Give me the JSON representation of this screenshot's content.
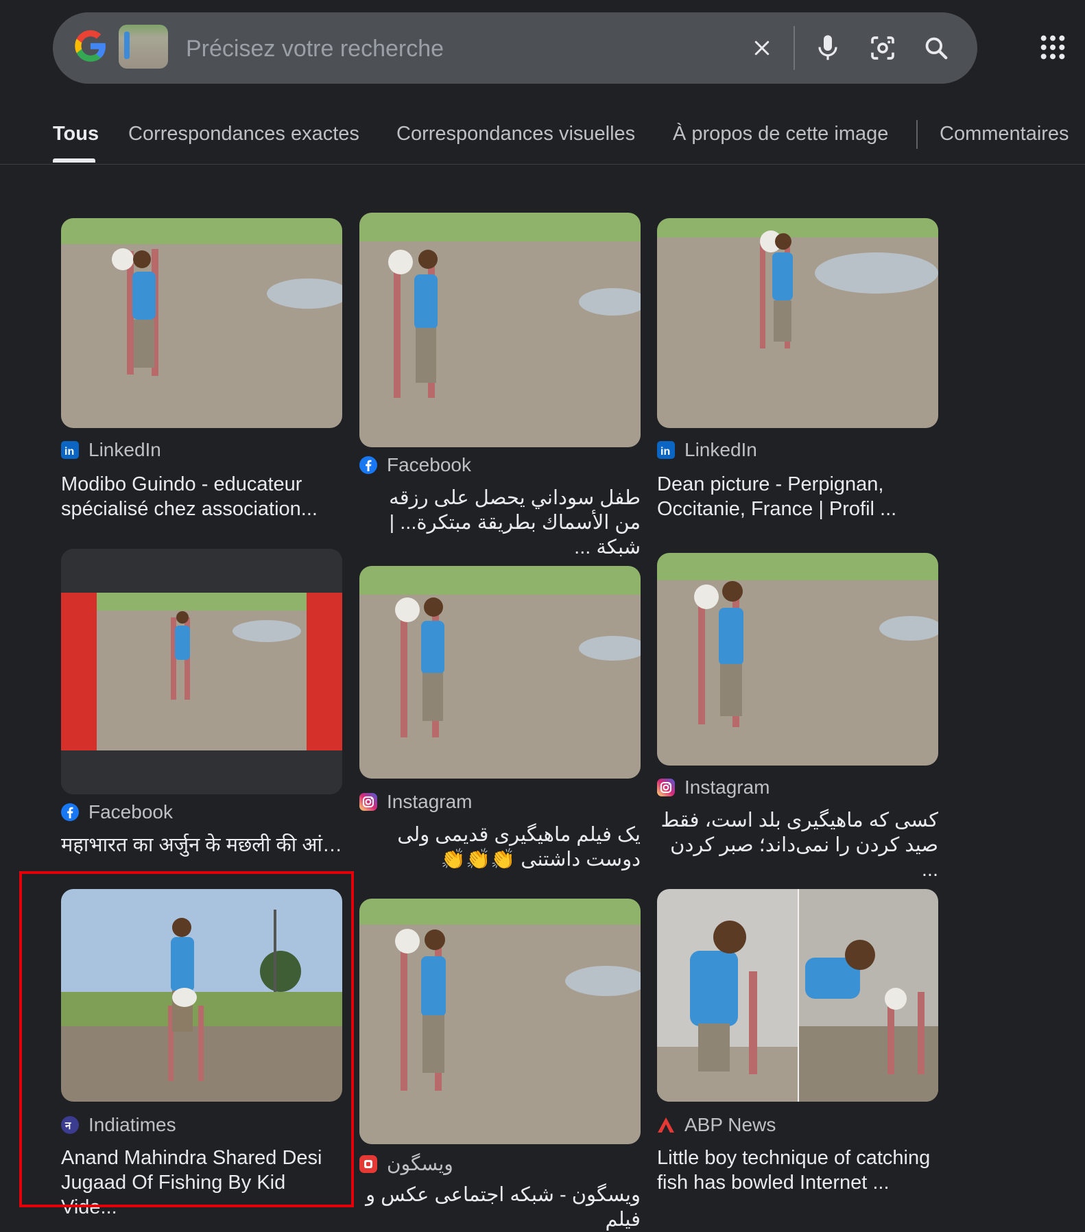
{
  "search": {
    "placeholder": "Précisez votre recherche"
  },
  "tabs": [
    {
      "label": "Tous",
      "active": true
    },
    {
      "label": "Correspondances exactes"
    },
    {
      "label": "Correspondances visuelles"
    },
    {
      "label": "À propos de cette image"
    },
    {
      "label": "Commentaires"
    }
  ],
  "results": [
    {
      "source": "LinkedIn",
      "title": "Modibo Guindo - educateur spécialisé chez association...",
      "icon": "linkedin-icon",
      "color": "#0a66c2"
    },
    {
      "source": "Facebook",
      "title": "طفل سوداني يحصل على رزقه من الأسماك بطريقة مبتكرة... | شبكة ...",
      "icon": "facebook-icon",
      "color": "#1877f2"
    },
    {
      "source": "LinkedIn",
      "title": "Dean picture - Perpignan, Occitanie, France | Profil ...",
      "icon": "linkedin-icon",
      "color": "#0a66c2"
    },
    {
      "source": "Facebook",
      "title": "महाभारत का अर्जुन के मछली की आंख ...",
      "icon": "facebook-icon",
      "color": "#1877f2"
    },
    {
      "source": "Instagram",
      "title": "یک فیلم ماهیگیری قدیمی ولی دوست داشتنی 👏👏👏",
      "icon": "instagram-icon",
      "color": "#e1306c"
    },
    {
      "source": "Instagram",
      "title": "کسی که ماهیگیری بلد است، فقط صید کردن را نمی‌داند؛ صبر کردن ...",
      "icon": "instagram-icon",
      "color": "#e1306c"
    },
    {
      "source": "Indiatimes",
      "title": "Anand Mahindra Shared Desi Jugaad Of Fishing By Kid Vide...",
      "icon": "indiatimes-icon",
      "color": "#3b3b8f"
    },
    {
      "source": "ویسگون",
      "title": "ویسگون - شبکه اجتماعی عکس و فیلم",
      "icon": "wisgoon-icon",
      "color": "#e53935"
    },
    {
      "source": "ABP News",
      "title": "Little boy technique of catching fish has bowled Internet ...",
      "icon": "abp-icon",
      "color": "#e53935"
    }
  ]
}
